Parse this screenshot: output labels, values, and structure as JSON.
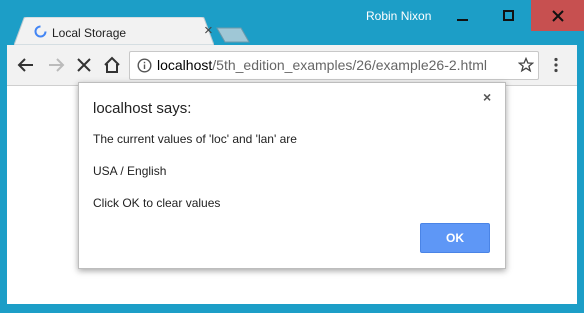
{
  "window": {
    "user_name": "Robin Nixon"
  },
  "tab": {
    "title": "Local Storage",
    "close_glyph": "×"
  },
  "toolbar": {
    "url_host": "localhost",
    "url_path": "/5th_edition_examples/26/example26-2.html"
  },
  "dialog": {
    "title": "localhost says:",
    "close_glyph": "×",
    "lines": [
      "The current values of 'loc' and 'lan' are",
      "USA / English",
      "Click OK to clear values"
    ],
    "ok_label": "OK"
  },
  "colors": {
    "window_frame": "#1c9ec7",
    "close_button": "#c75050",
    "ok_button": "#5e97f6"
  },
  "icons": [
    "spinner-icon",
    "back-icon",
    "forward-icon",
    "stop-icon",
    "home-icon",
    "info-icon",
    "star-icon",
    "menu-icon",
    "minimize-icon",
    "maximize-icon",
    "close-icon"
  ]
}
